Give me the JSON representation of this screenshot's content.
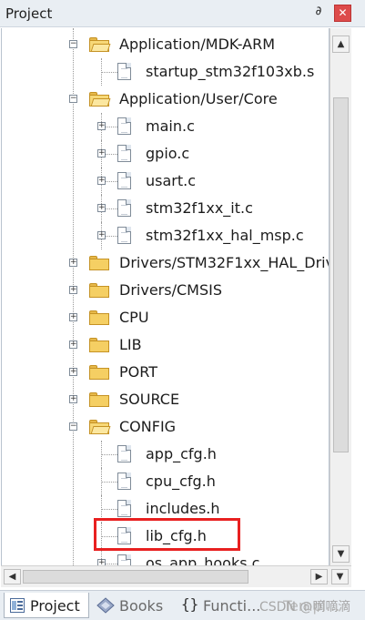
{
  "panel": {
    "title": "Project",
    "pin_glyph": "∂",
    "close_glyph": "✕"
  },
  "tree": [
    {
      "type": "folder",
      "open": true,
      "label": "Application/MDK-ARM"
    },
    {
      "type": "file",
      "label": "startup_stm32f103xb.s"
    },
    {
      "type": "folder",
      "open": true,
      "label": "Application/User/Core"
    },
    {
      "type": "file",
      "expandable": true,
      "label": "main.c"
    },
    {
      "type": "file",
      "expandable": true,
      "label": "gpio.c"
    },
    {
      "type": "file",
      "expandable": true,
      "label": "usart.c"
    },
    {
      "type": "file",
      "expandable": true,
      "label": "stm32f1xx_it.c"
    },
    {
      "type": "file",
      "expandable": true,
      "label": "stm32f1xx_hal_msp.c"
    },
    {
      "type": "folder",
      "open": false,
      "label": "Drivers/STM32F1xx_HAL_Driv"
    },
    {
      "type": "folder",
      "open": false,
      "label": "Drivers/CMSIS"
    },
    {
      "type": "folder",
      "open": false,
      "label": "CPU"
    },
    {
      "type": "folder",
      "open": false,
      "label": "LIB"
    },
    {
      "type": "folder",
      "open": false,
      "label": "PORT"
    },
    {
      "type": "folder",
      "open": false,
      "label": "SOURCE"
    },
    {
      "type": "folder",
      "open": true,
      "label": "CONFIG"
    },
    {
      "type": "file",
      "label": "app_cfg.h"
    },
    {
      "type": "file",
      "label": "cpu_cfg.h"
    },
    {
      "type": "file",
      "label": "includes.h"
    },
    {
      "type": "file",
      "label": "lib_cfg.h",
      "highlighted": true
    },
    {
      "type": "file",
      "expandable": true,
      "label": "os_app_hooks.c"
    }
  ],
  "scrollbars": {
    "up": "▲",
    "down": "▼",
    "left": "◀",
    "right": "▶"
  },
  "tabs": [
    {
      "label": "Project",
      "icon": "project-icon",
      "active": true
    },
    {
      "label": "Books",
      "icon": "books-icon",
      "active": false
    },
    {
      "label": "Functi...",
      "icon": "functions-icon",
      "active": false
    },
    {
      "label": "Templ...",
      "icon": "templates-icon",
      "active": false
    }
  ],
  "watermark": "CSDN @嘀嘀滴"
}
